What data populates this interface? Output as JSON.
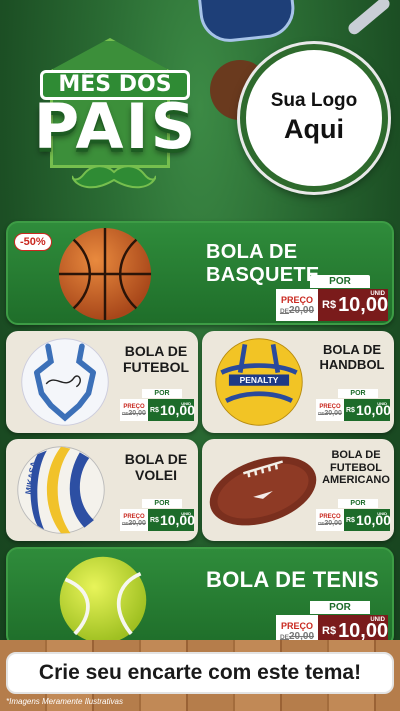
{
  "header": {
    "title_top": "MÊS DOS",
    "title_main": "PAIS",
    "logo_line1": "Sua Logo",
    "logo_line2": "Aqui"
  },
  "products": [
    {
      "id": "basquete",
      "name": "BOLA DE BASQUETE",
      "discount": "-50%",
      "por": "POR",
      "preco_label": "PREÇO",
      "de_label": "DE",
      "old_price": "20,00",
      "currency": "R$",
      "price": "10,00",
      "unit": "UNID"
    },
    {
      "id": "futebol",
      "name_line1": "BOLA DE",
      "name_line2": "FUTEBOL",
      "por": "POR",
      "preco_label": "PREÇO",
      "de_label": "DE",
      "old_price": "20,00",
      "currency": "R$",
      "price": "10,00",
      "unit": "UNID"
    },
    {
      "id": "handbol",
      "name_line1": "BOLA DE",
      "name_line2": "HANDBOL",
      "por": "POR",
      "preco_label": "PREÇO",
      "de_label": "DE",
      "old_price": "20,00",
      "currency": "R$",
      "price": "10,00",
      "unit": "UNID"
    },
    {
      "id": "volei",
      "name_line1": "BOLA DE",
      "name_line2": "VOLEI",
      "por": "POR",
      "preco_label": "PREÇO",
      "de_label": "DE",
      "old_price": "20,00",
      "currency": "R$",
      "price": "10,00",
      "unit": "UNID"
    },
    {
      "id": "futebol-americano",
      "name_line1": "BOLA DE",
      "name_line2": "FUTEBOL",
      "name_line3": "AMERICANO",
      "por": "POR",
      "preco_label": "PREÇO",
      "de_label": "DE",
      "old_price": "20,00",
      "currency": "R$",
      "price": "10,00",
      "unit": "UNID"
    },
    {
      "id": "tenis",
      "name": "BOLA DE TENIS",
      "por": "POR",
      "preco_label": "PREÇO",
      "de_label": "DE",
      "old_price": "20,00",
      "currency": "R$",
      "price": "10,00",
      "unit": "UNID"
    }
  ],
  "balls": {
    "penalty_brand": "PENALTY",
    "mikasa_brand": "MIKASA"
  },
  "footer": {
    "cta": "Crie seu encarte com este tema!",
    "disclaimer": "*Imagens Meramente Ilustrativas"
  },
  "colors": {
    "green_dark": "#1f6e2a",
    "green_light": "#3d9c45",
    "price_red": "#7a1b1b",
    "tag_red": "#c9281f"
  }
}
